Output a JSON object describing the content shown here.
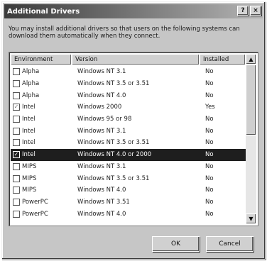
{
  "window": {
    "title": "Additional Drivers",
    "help_glyph": "?",
    "close_glyph": "×"
  },
  "description": "You may install additional drivers so that users on the following systems can download them automatically when they connect.",
  "list": {
    "columns": [
      "Environment",
      "Version",
      "Installed"
    ],
    "rows": [
      {
        "environment": "Alpha",
        "version": "Windows NT 3.1",
        "installed": "No",
        "checked": false
      },
      {
        "environment": "Alpha",
        "version": "Windows NT 3.5 or 3.51",
        "installed": "No",
        "checked": false
      },
      {
        "environment": "Alpha",
        "version": "Windows NT 4.0",
        "installed": "No",
        "checked": false
      },
      {
        "environment": "Intel",
        "version": "Windows 2000",
        "installed": "Yes",
        "checked": true
      },
      {
        "environment": "Intel",
        "version": "Windows 95 or 98",
        "installed": "No",
        "checked": false
      },
      {
        "environment": "Intel",
        "version": "Windows NT 3.1",
        "installed": "No",
        "checked": false
      },
      {
        "environment": "Intel",
        "version": "Windows NT 3.5 or 3.51",
        "installed": "No",
        "checked": false
      },
      {
        "environment": "Intel",
        "version": "Windows NT 4.0 or 2000",
        "installed": "No",
        "checked": true,
        "selected": true
      },
      {
        "environment": "MIPS",
        "version": "Windows NT 3.1",
        "installed": "No",
        "checked": false
      },
      {
        "environment": "MIPS",
        "version": "Windows NT 3.5 or 3.51",
        "installed": "No",
        "checked": false
      },
      {
        "environment": "MIPS",
        "version": "Windows NT 4.0",
        "installed": "No",
        "checked": false
      },
      {
        "environment": "PowerPC",
        "version": "Windows NT 3.51",
        "installed": "No",
        "checked": false
      },
      {
        "environment": "PowerPC",
        "version": "Windows NT 4.0",
        "installed": "No",
        "checked": false
      }
    ],
    "scroll_up_glyph": "▲",
    "scroll_down_glyph": "▼"
  },
  "buttons": {
    "ok": "OK",
    "cancel": "Cancel"
  }
}
